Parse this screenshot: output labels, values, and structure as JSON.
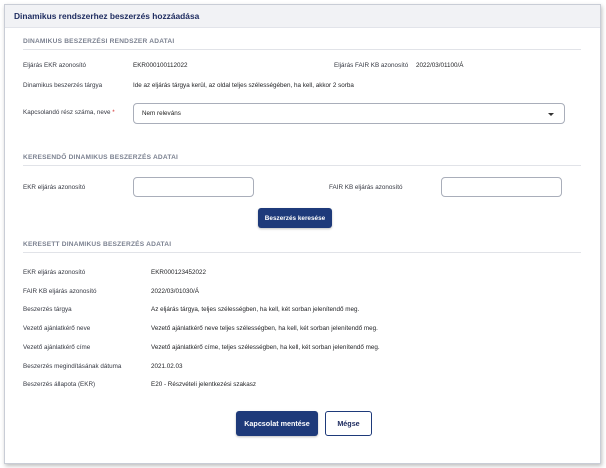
{
  "window": {
    "title": "Dinamikus rendszerhez beszerzés hozzáadása"
  },
  "section_system": {
    "heading": "DINAMIKUS BESZERZÉSI RENDSZER ADATAI",
    "ekr_label": "Eljárás EKR azonosító",
    "ekr_value": "EKR000100112022",
    "fair_label": "Eljárás FAIR KB azonosító",
    "fair_value": "2022/03/01100/Á",
    "subject_label": "Dinamikus beszerzés tárgya",
    "subject_value": "Ide az eljárás tárgya kerül, az oldal teljes szélességében, ha kell, akkor 2 sorba",
    "part_label": "Kapcsolandó rész száma, neve",
    "part_required_mark": "*",
    "part_selected": "Nem releváns"
  },
  "section_search": {
    "heading": "KERESENDŐ DINAMIKUS BESZERZÉS ADATAI",
    "ekr_label": "EKR eljárás azonosító",
    "ekr_value": "",
    "fair_label": "FAIR KB  eljárás azonosító",
    "fair_value": "",
    "search_button": "Beszerzés keresése"
  },
  "section_found": {
    "heading": "KERESETT DINAMIKUS BESZERZÉS ADATAI",
    "rows": [
      {
        "label": "EKR eljárás azonosító",
        "value": "EKR000123452022"
      },
      {
        "label": "FAIR KB  eljárás azonosító",
        "value": "2022/03/01030/Á"
      },
      {
        "label": "Beszerzés tárgya",
        "value": "Az eljárás tárgya, teljes szélességben, ha kell, két sorban jelenítendő meg."
      },
      {
        "label": "Vezető ajánlatkérő neve",
        "value": "Vezető ajánlatkérő neve teljes szélességben, ha kell, két sorban jelenítendő meg."
      },
      {
        "label": "Vezető ajánlatkérő címe",
        "value": "Vezető ajánlatkérő címe, teljes szélességben, ha kell, két sorban jelenítendő meg."
      },
      {
        "label": "Beszerzés megindításának dátuma",
        "value": "2021.02.03"
      },
      {
        "label": "Beszerzés állapota  (EKR)",
        "value": "E20 - Részvételi jelentkezési szakasz"
      }
    ]
  },
  "footer": {
    "save_button": "Kapcsolat mentése",
    "cancel_button": "Mégse"
  }
}
